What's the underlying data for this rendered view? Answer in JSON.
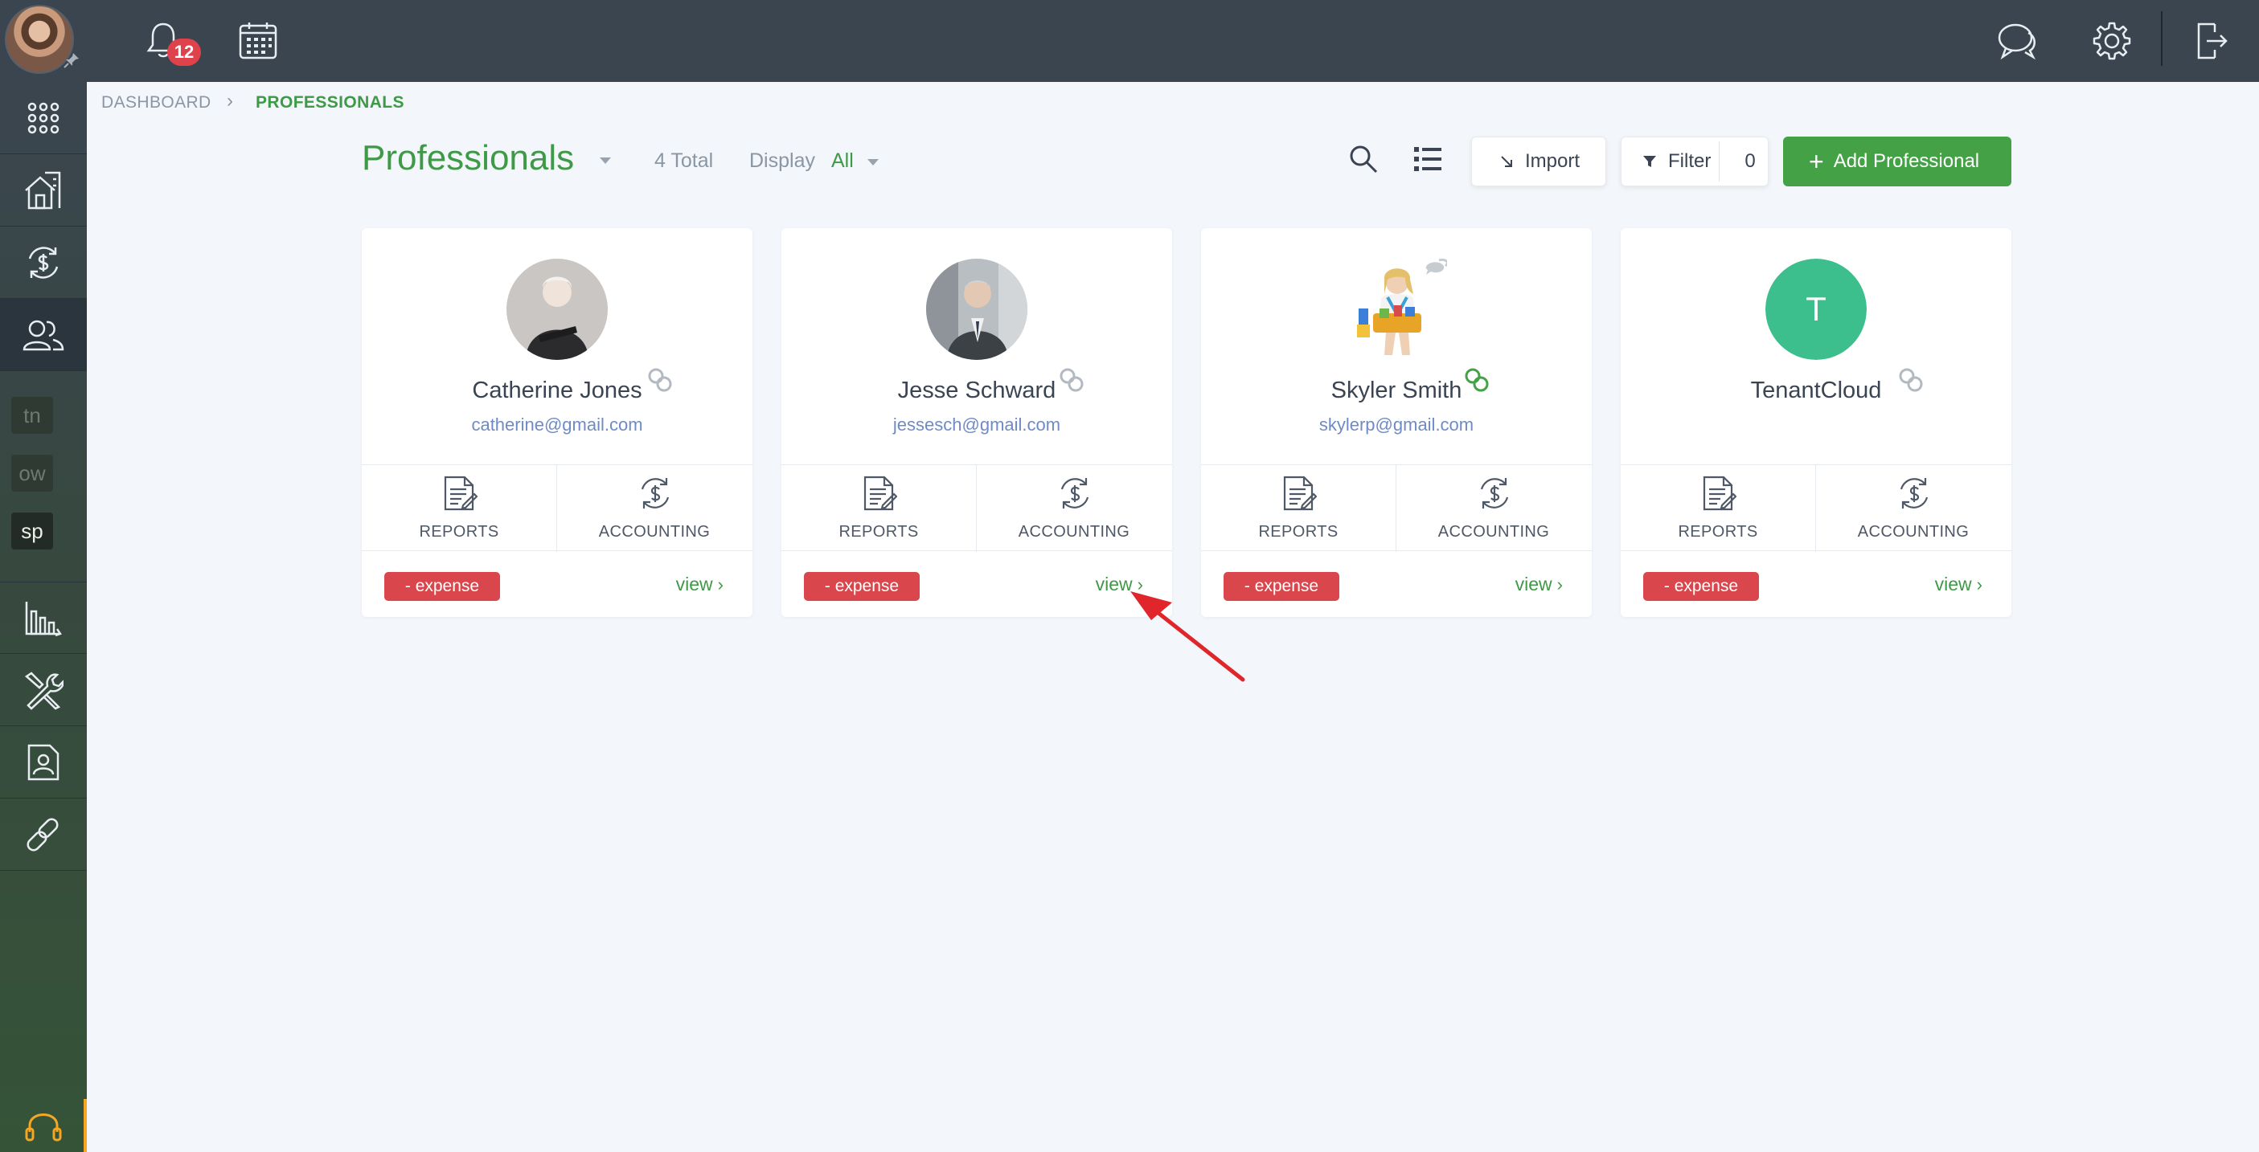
{
  "topbar": {
    "notification_count": "12",
    "icons": [
      "bell-icon",
      "calendar-icon",
      "chat-icon",
      "gear-icon",
      "logout-icon"
    ]
  },
  "sidebar": {
    "items": [
      "apps-grid-icon",
      "properties-icon",
      "payments-icon",
      "professionals-icon",
      "reports-icon",
      "tools-icon",
      "applications-icon",
      "links-icon"
    ],
    "chips": [
      "tn",
      "ow",
      "sp"
    ],
    "active": "professionals-icon"
  },
  "breadcrumb": {
    "root": "DASHBOARD",
    "separator": "›",
    "current": "PROFESSIONALS"
  },
  "header": {
    "title": "Professionals",
    "total": "4 Total",
    "display_label": "Display",
    "display_value": "All",
    "import_label": "Import",
    "filter_label": "Filter",
    "filter_count": "0",
    "add_label": "Add Professional"
  },
  "cards": [
    {
      "name": "Catherine Jones",
      "email": "catherine@gmail.com",
      "reports": "REPORTS",
      "accounting": "ACCOUNTING",
      "tag": "- expense",
      "view": "view",
      "linked": false
    },
    {
      "name": "Jesse Schward",
      "email": "jessesch@gmail.com",
      "reports": "REPORTS",
      "accounting": "ACCOUNTING",
      "tag": "- expense",
      "view": "view",
      "linked": false
    },
    {
      "name": "Skyler Smith",
      "email": "skylerp@gmail.com",
      "reports": "REPORTS",
      "accounting": "ACCOUNTING",
      "tag": "- expense",
      "view": "view",
      "linked": true
    },
    {
      "name": "TenantCloud",
      "initial": "T",
      "reports": "REPORTS",
      "accounting": "ACCOUNTING",
      "tag": "- expense",
      "view": "view",
      "linked": false
    }
  ],
  "colors": {
    "topbar": "#3a4550",
    "accent_green": "#45a146",
    "expense_red": "#d9464b",
    "email_blue": "#6f8bc7",
    "annotation_arrow": "#e0262a"
  }
}
